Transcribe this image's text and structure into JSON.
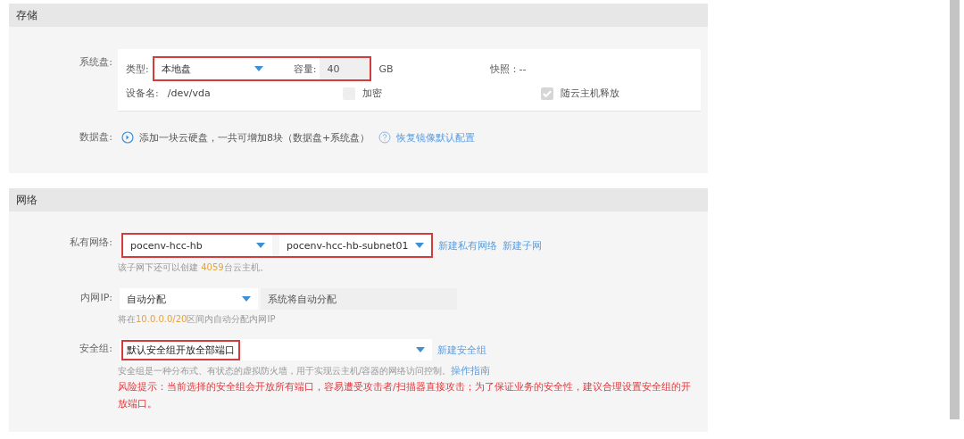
{
  "storage": {
    "title": "存储",
    "system_disk": {
      "label": "系统盘:",
      "highlighted": true,
      "type_label": "类型:",
      "type_value": "本地盘",
      "capacity_label": "容量:",
      "capacity_value": "40",
      "unit": "GB",
      "snapshot": "快照：--",
      "device_label": "设备名:",
      "device_value": "/dev/vda",
      "encrypt": {
        "label": "加密",
        "checked": false,
        "disabled": false
      },
      "release": {
        "label": "随云主机释放",
        "checked": true,
        "disabled": true
      }
    },
    "data_disk": {
      "label": "数据盘:",
      "text": "添加一块云硬盘，一共可增加8块（数据盘+系统盘）",
      "link": "恢复镜像默认配置"
    }
  },
  "network": {
    "title": "网络",
    "private_network": {
      "label": "私有网络:",
      "highlighted": true,
      "vpc": "pocenv-hcc-hb",
      "subnet": "pocenv-hcc-hb-subnet01",
      "links": [
        "新建私有网络",
        "新建子网"
      ],
      "hint_before": "该子网下还可以创建 ",
      "hint_count": "4059",
      "hint_after": "台云主机。"
    },
    "internal_ip": {
      "label": "内网IP:",
      "mode": "自动分配",
      "value": "系统将自动分配",
      "hint_before": "将在",
      "hint_range": "10.0.0.0/20",
      "hint_after": "区间内自动分配内网IP"
    },
    "security_group": {
      "label": "安全组:",
      "highlighted": true,
      "value": "默认安全组开放全部端口",
      "link": "新建安全组",
      "description": "安全组是一种分布式、有状态的虚拟防火墙，用于实现云主机/容器的网络访问控制。",
      "guide_link": "操作指南",
      "warning": "风险提示：当前选择的安全组会开放所有端口，容易遭受攻击者/扫描器直接攻击；为了保证业务的安全性，建议合理设置安全组的开放端口。"
    }
  }
}
